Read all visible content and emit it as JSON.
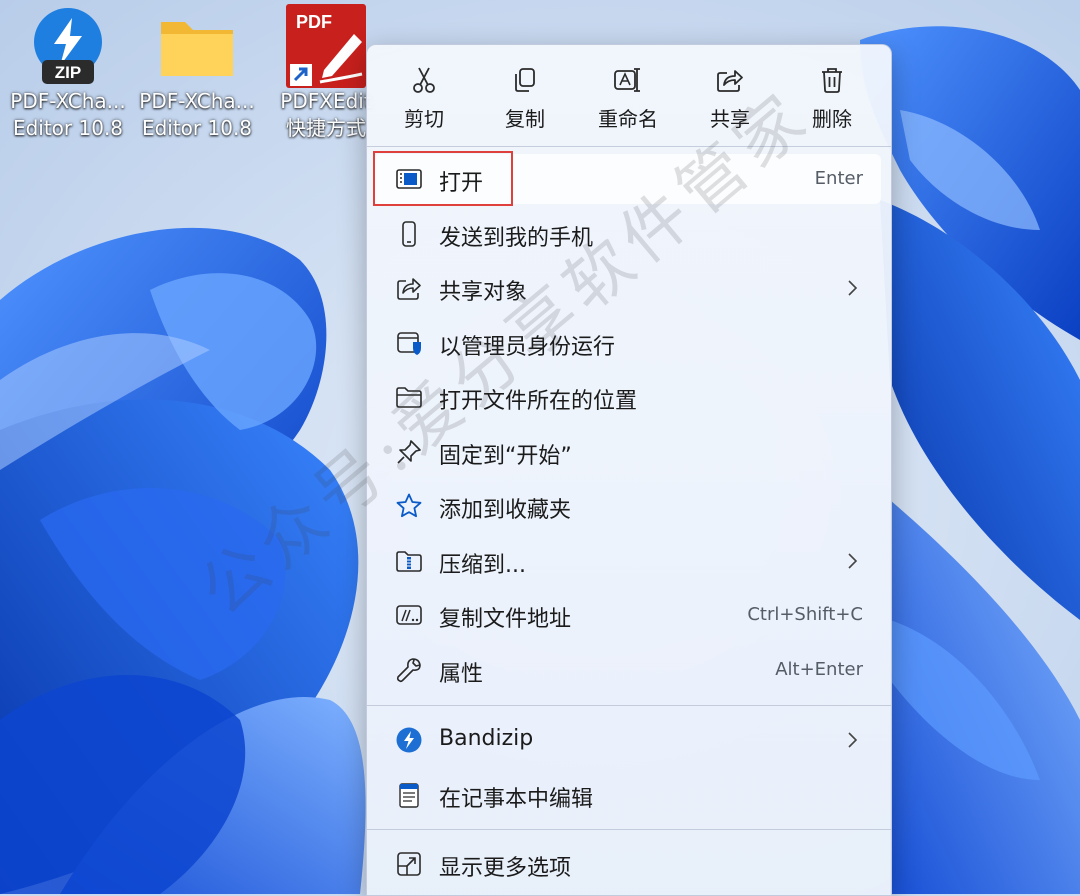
{
  "desktop": {
    "icons": [
      {
        "line1": "PDF-XCha...",
        "line2": "Editor 10.8",
        "icon": "bandizip-zip-icon",
        "badge": "ZIP"
      },
      {
        "line1": "PDF-XCha...",
        "line2": "Editor 10.8",
        "icon": "folder-icon"
      },
      {
        "line1": "PDFXEdit",
        "line2": "快捷方式",
        "icon": "pdf-xchange-shortcut-icon",
        "badge": "PDF"
      }
    ]
  },
  "menu": {
    "quick_actions": [
      {
        "label": "剪切",
        "icon": "scissors-icon"
      },
      {
        "label": "复制",
        "icon": "copy-icon"
      },
      {
        "label": "重命名",
        "icon": "rename-icon"
      },
      {
        "label": "共享",
        "icon": "share-icon"
      },
      {
        "label": "删除",
        "icon": "trash-icon"
      }
    ],
    "items": [
      {
        "label": "打开",
        "shortcut": "Enter",
        "icon": "open-app-icon"
      },
      {
        "label": "发送到我的手机",
        "icon": "phone-icon"
      },
      {
        "label": "共享对象",
        "icon": "share-icon",
        "submenu": true
      },
      {
        "label": "以管理员身份运行",
        "icon": "shield-icon"
      },
      {
        "label": "打开文件所在的位置",
        "icon": "folder-icon"
      },
      {
        "label": "固定到“开始”",
        "icon": "pin-icon"
      },
      {
        "label": "添加到收藏夹",
        "icon": "star-icon"
      },
      {
        "label": "压缩到...",
        "icon": "zip-folder-icon",
        "submenu": true
      },
      {
        "label": "复制文件地址",
        "shortcut": "Ctrl+Shift+C",
        "icon": "copy-path-icon"
      },
      {
        "label": "属性",
        "shortcut": "Alt+Enter",
        "icon": "wrench-icon"
      },
      {
        "label": "Bandizip",
        "icon": "bandizip-icon",
        "submenu": true
      },
      {
        "label": "在记事本中编辑",
        "icon": "notepad-icon"
      },
      {
        "label": "显示更多选项",
        "icon": "more-options-icon"
      }
    ]
  },
  "watermark": "公众号:爱分享软件管家",
  "colors": {
    "accent": "#0a5ac8",
    "highlight_box": "#e0403c"
  }
}
